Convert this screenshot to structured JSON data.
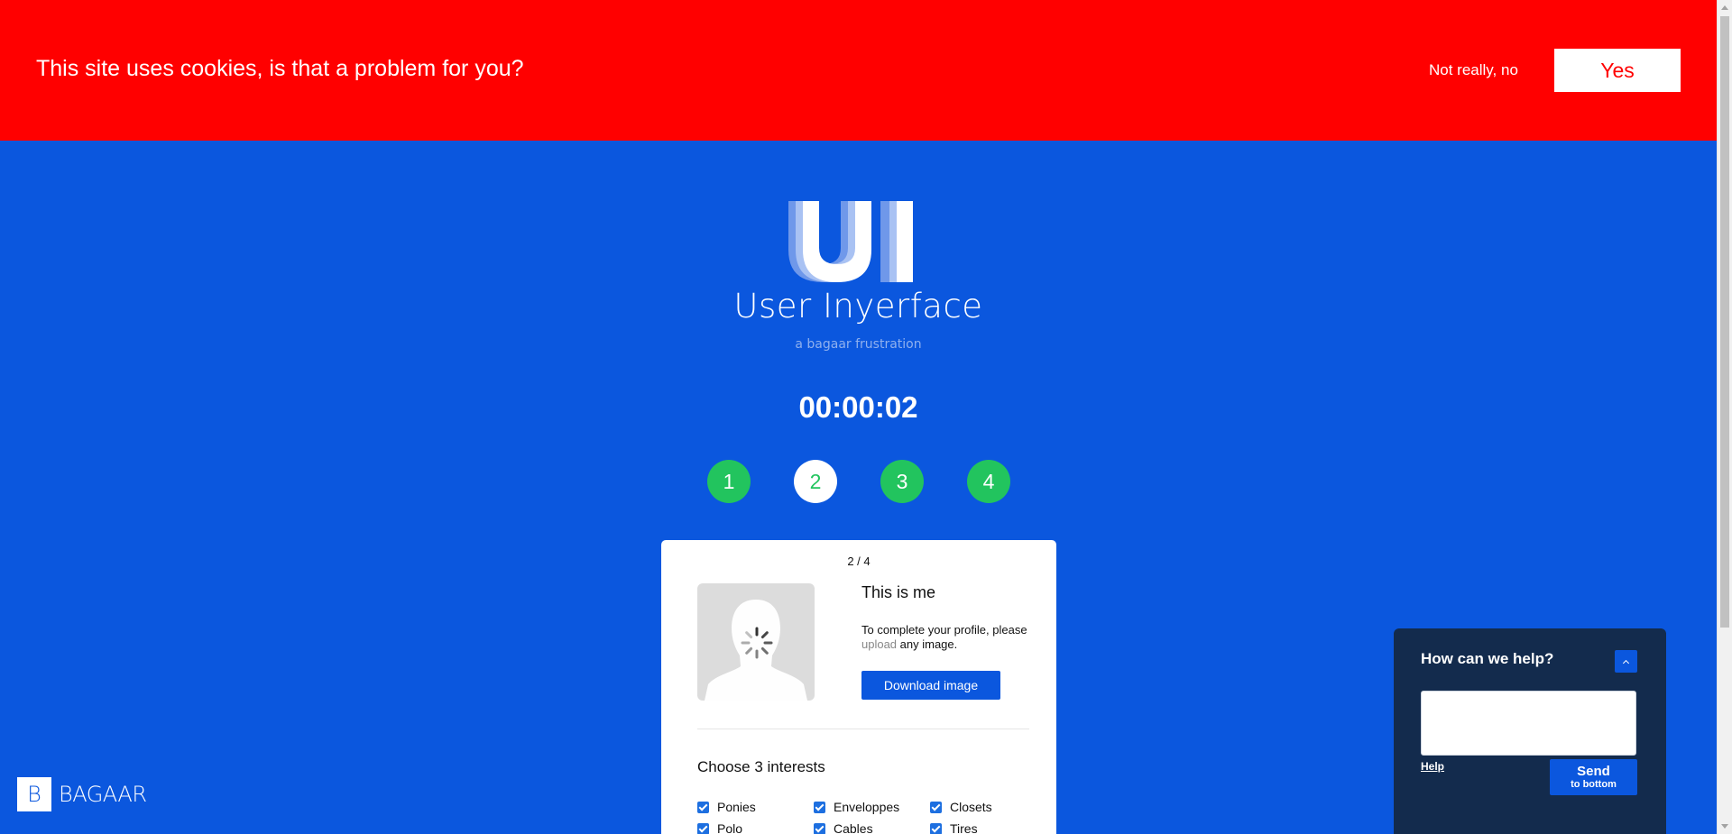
{
  "cookie_banner": {
    "text": "This site uses cookies, is that a problem for you?",
    "decline_label": "Not really, no",
    "accept_label": "Yes"
  },
  "header": {
    "logo_text": "UI",
    "title": "User Inyerface",
    "subtitle": "a bagaar frustration"
  },
  "timer": "00:00:02",
  "steps": [
    {
      "label": "1",
      "active": false
    },
    {
      "label": "2",
      "active": true
    },
    {
      "label": "3",
      "active": false
    },
    {
      "label": "4",
      "active": false
    }
  ],
  "card": {
    "progress": "2 / 4",
    "heading": "This is me",
    "desc_prefix": "To complete your profile, please ",
    "upload_link": "upload",
    "desc_suffix": " any image.",
    "download_label": "Download image",
    "interests_heading": "Choose 3 interests",
    "interests": [
      {
        "label": "Ponies",
        "checked": true
      },
      {
        "label": "Enveloppes",
        "checked": true
      },
      {
        "label": "Closets",
        "checked": true
      },
      {
        "label": "Polo",
        "checked": true
      },
      {
        "label": "Cables",
        "checked": true
      },
      {
        "label": "Tires",
        "checked": true
      }
    ]
  },
  "footer": {
    "brand_letter": "B",
    "brand_name": "BAGAAR"
  },
  "help_widget": {
    "title": "How can we help?",
    "help_link": "Help",
    "send_label": "Send",
    "send_sublabel": "to bottom"
  },
  "colors": {
    "background": "#0b57de",
    "banner": "#ff0000",
    "step_green": "#22c45e",
    "widget_bg": "#132b4d"
  }
}
